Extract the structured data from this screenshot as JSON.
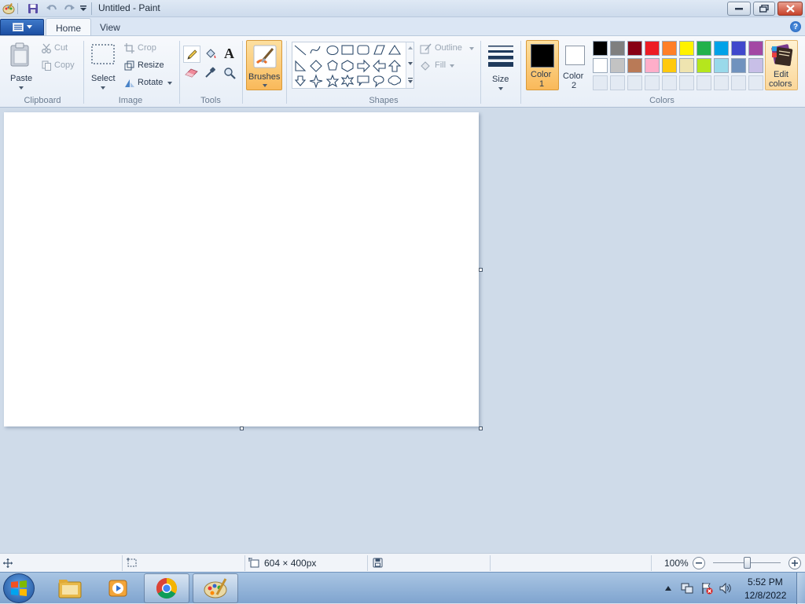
{
  "window": {
    "title": "Untitled - Paint"
  },
  "tabs": [
    {
      "label": "Home"
    },
    {
      "label": "View"
    }
  ],
  "clipboard": {
    "paste": "Paste",
    "cut": "Cut",
    "copy": "Copy",
    "group": "Clipboard"
  },
  "image": {
    "select": "Select",
    "crop": "Crop",
    "resize": "Resize",
    "rotate": "Rotate",
    "group": "Image"
  },
  "tools": {
    "group": "Tools"
  },
  "brushes": {
    "label": "Brushes"
  },
  "shapes": {
    "outline": "Outline",
    "fill": "Fill",
    "group": "Shapes"
  },
  "size": {
    "label": "Size"
  },
  "colors": {
    "color1_label": "Color",
    "color1_num": "1",
    "color2_label": "Color",
    "color2_num": "2",
    "edit_label": "Edit",
    "edit_label2": "colors",
    "group": "Colors",
    "color1": "#000000",
    "color2": "#ffffff",
    "palette_row1": [
      "#000000",
      "#7f7f7f",
      "#880015",
      "#ed1c24",
      "#ff7f27",
      "#fff200",
      "#22b14c",
      "#00a2e8",
      "#3f48cc",
      "#a349a4"
    ],
    "palette_row2": [
      "#ffffff",
      "#c3c3c3",
      "#b97a57",
      "#ffaec9",
      "#ffc90e",
      "#efe4b0",
      "#b5e61d",
      "#99d9ea",
      "#7092be",
      "#c8bfe7"
    ]
  },
  "status": {
    "dimensions": "604 × 400px",
    "zoom": "100%"
  },
  "taskbar": {
    "time": "5:52 PM",
    "date": "12/8/2022"
  }
}
